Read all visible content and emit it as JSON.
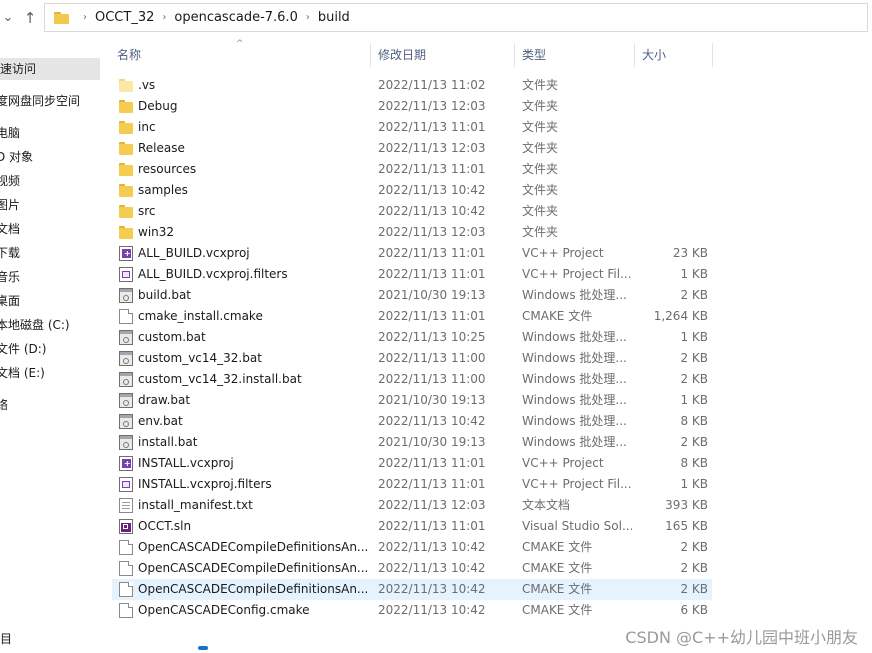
{
  "address": {
    "crumbs": [
      "OCCT_32",
      "opencascade-7.6.0",
      "build"
    ]
  },
  "navpane": {
    "items": [
      {
        "label": "速访问",
        "selected": true
      },
      {
        "label": "度网盘同步空间",
        "selected": false
      },
      {
        "label": "电脑",
        "selected": false
      },
      {
        "label": "D 对象",
        "selected": false
      },
      {
        "label": "视频",
        "selected": false
      },
      {
        "label": "图片",
        "selected": false
      },
      {
        "label": "文档",
        "selected": false
      },
      {
        "label": "下载",
        "selected": false
      },
      {
        "label": "音乐",
        "selected": false
      },
      {
        "label": "桌面",
        "selected": false
      },
      {
        "label": "本地磁盘 (C:)",
        "selected": false
      },
      {
        "label": "文件 (D:)",
        "selected": false
      },
      {
        "label": "文档 (E:)",
        "selected": false
      },
      {
        "label": "络",
        "selected": false
      }
    ],
    "bottom_fragment": "目"
  },
  "columns": {
    "name": "名称",
    "date": "修改日期",
    "type": "类型",
    "size": "大小"
  },
  "files": [
    {
      "name": ".vs",
      "date": "2022/11/13 11:02",
      "type": "文件夹",
      "size": "",
      "icon": "folder-light"
    },
    {
      "name": "Debug",
      "date": "2022/11/13 12:03",
      "type": "文件夹",
      "size": "",
      "icon": "folder"
    },
    {
      "name": "inc",
      "date": "2022/11/13 11:01",
      "type": "文件夹",
      "size": "",
      "icon": "folder"
    },
    {
      "name": "Release",
      "date": "2022/11/13 12:03",
      "type": "文件夹",
      "size": "",
      "icon": "folder"
    },
    {
      "name": "resources",
      "date": "2022/11/13 11:01",
      "type": "文件夹",
      "size": "",
      "icon": "folder"
    },
    {
      "name": "samples",
      "date": "2022/11/13 10:42",
      "type": "文件夹",
      "size": "",
      "icon": "folder"
    },
    {
      "name": "src",
      "date": "2022/11/13 10:42",
      "type": "文件夹",
      "size": "",
      "icon": "folder"
    },
    {
      "name": "win32",
      "date": "2022/11/13 12:03",
      "type": "文件夹",
      "size": "",
      "icon": "folder"
    },
    {
      "name": "ALL_BUILD.vcxproj",
      "date": "2022/11/13 11:01",
      "type": "VC++ Project",
      "size": "23 KB",
      "icon": "vcxproj"
    },
    {
      "name": "ALL_BUILD.vcxproj.filters",
      "date": "2022/11/13 11:01",
      "type": "VC++ Project Fil...",
      "size": "1 KB",
      "icon": "filters"
    },
    {
      "name": "build.bat",
      "date": "2021/10/30 19:13",
      "type": "Windows 批处理...",
      "size": "2 KB",
      "icon": "bat"
    },
    {
      "name": "cmake_install.cmake",
      "date": "2022/11/13 11:01",
      "type": "CMAKE 文件",
      "size": "1,264 KB",
      "icon": "doc"
    },
    {
      "name": "custom.bat",
      "date": "2022/11/13 10:25",
      "type": "Windows 批处理...",
      "size": "1 KB",
      "icon": "bat"
    },
    {
      "name": "custom_vc14_32.bat",
      "date": "2022/11/13 11:00",
      "type": "Windows 批处理...",
      "size": "2 KB",
      "icon": "bat"
    },
    {
      "name": "custom_vc14_32.install.bat",
      "date": "2022/11/13 11:00",
      "type": "Windows 批处理...",
      "size": "2 KB",
      "icon": "bat"
    },
    {
      "name": "draw.bat",
      "date": "2021/10/30 19:13",
      "type": "Windows 批处理...",
      "size": "1 KB",
      "icon": "bat"
    },
    {
      "name": "env.bat",
      "date": "2022/11/13 10:42",
      "type": "Windows 批处理...",
      "size": "8 KB",
      "icon": "bat"
    },
    {
      "name": "install.bat",
      "date": "2021/10/30 19:13",
      "type": "Windows 批处理...",
      "size": "2 KB",
      "icon": "bat"
    },
    {
      "name": "INSTALL.vcxproj",
      "date": "2022/11/13 11:01",
      "type": "VC++ Project",
      "size": "8 KB",
      "icon": "vcxproj"
    },
    {
      "name": "INSTALL.vcxproj.filters",
      "date": "2022/11/13 11:01",
      "type": "VC++ Project Fil...",
      "size": "1 KB",
      "icon": "filters"
    },
    {
      "name": "install_manifest.txt",
      "date": "2022/11/13 12:03",
      "type": "文本文档",
      "size": "393 KB",
      "icon": "txt"
    },
    {
      "name": "OCCT.sln",
      "date": "2022/11/13 11:01",
      "type": "Visual Studio Sol...",
      "size": "165 KB",
      "icon": "sln"
    },
    {
      "name": "OpenCASCADECompileDefinitionsAn...",
      "date": "2022/11/13 10:42",
      "type": "CMAKE 文件",
      "size": "2 KB",
      "icon": "doc"
    },
    {
      "name": "OpenCASCADECompileDefinitionsAn...",
      "date": "2022/11/13 10:42",
      "type": "CMAKE 文件",
      "size": "2 KB",
      "icon": "doc"
    },
    {
      "name": "OpenCASCADECompileDefinitionsAn...",
      "date": "2022/11/13 10:42",
      "type": "CMAKE 文件",
      "size": "2 KB",
      "icon": "doc",
      "selected": true
    },
    {
      "name": "OpenCASCADEConfig.cmake",
      "date": "2022/11/13 10:42",
      "type": "CMAKE 文件",
      "size": "6 KB",
      "icon": "doc"
    }
  ],
  "watermark": "CSDN @C++幼儿园中班小朋友"
}
